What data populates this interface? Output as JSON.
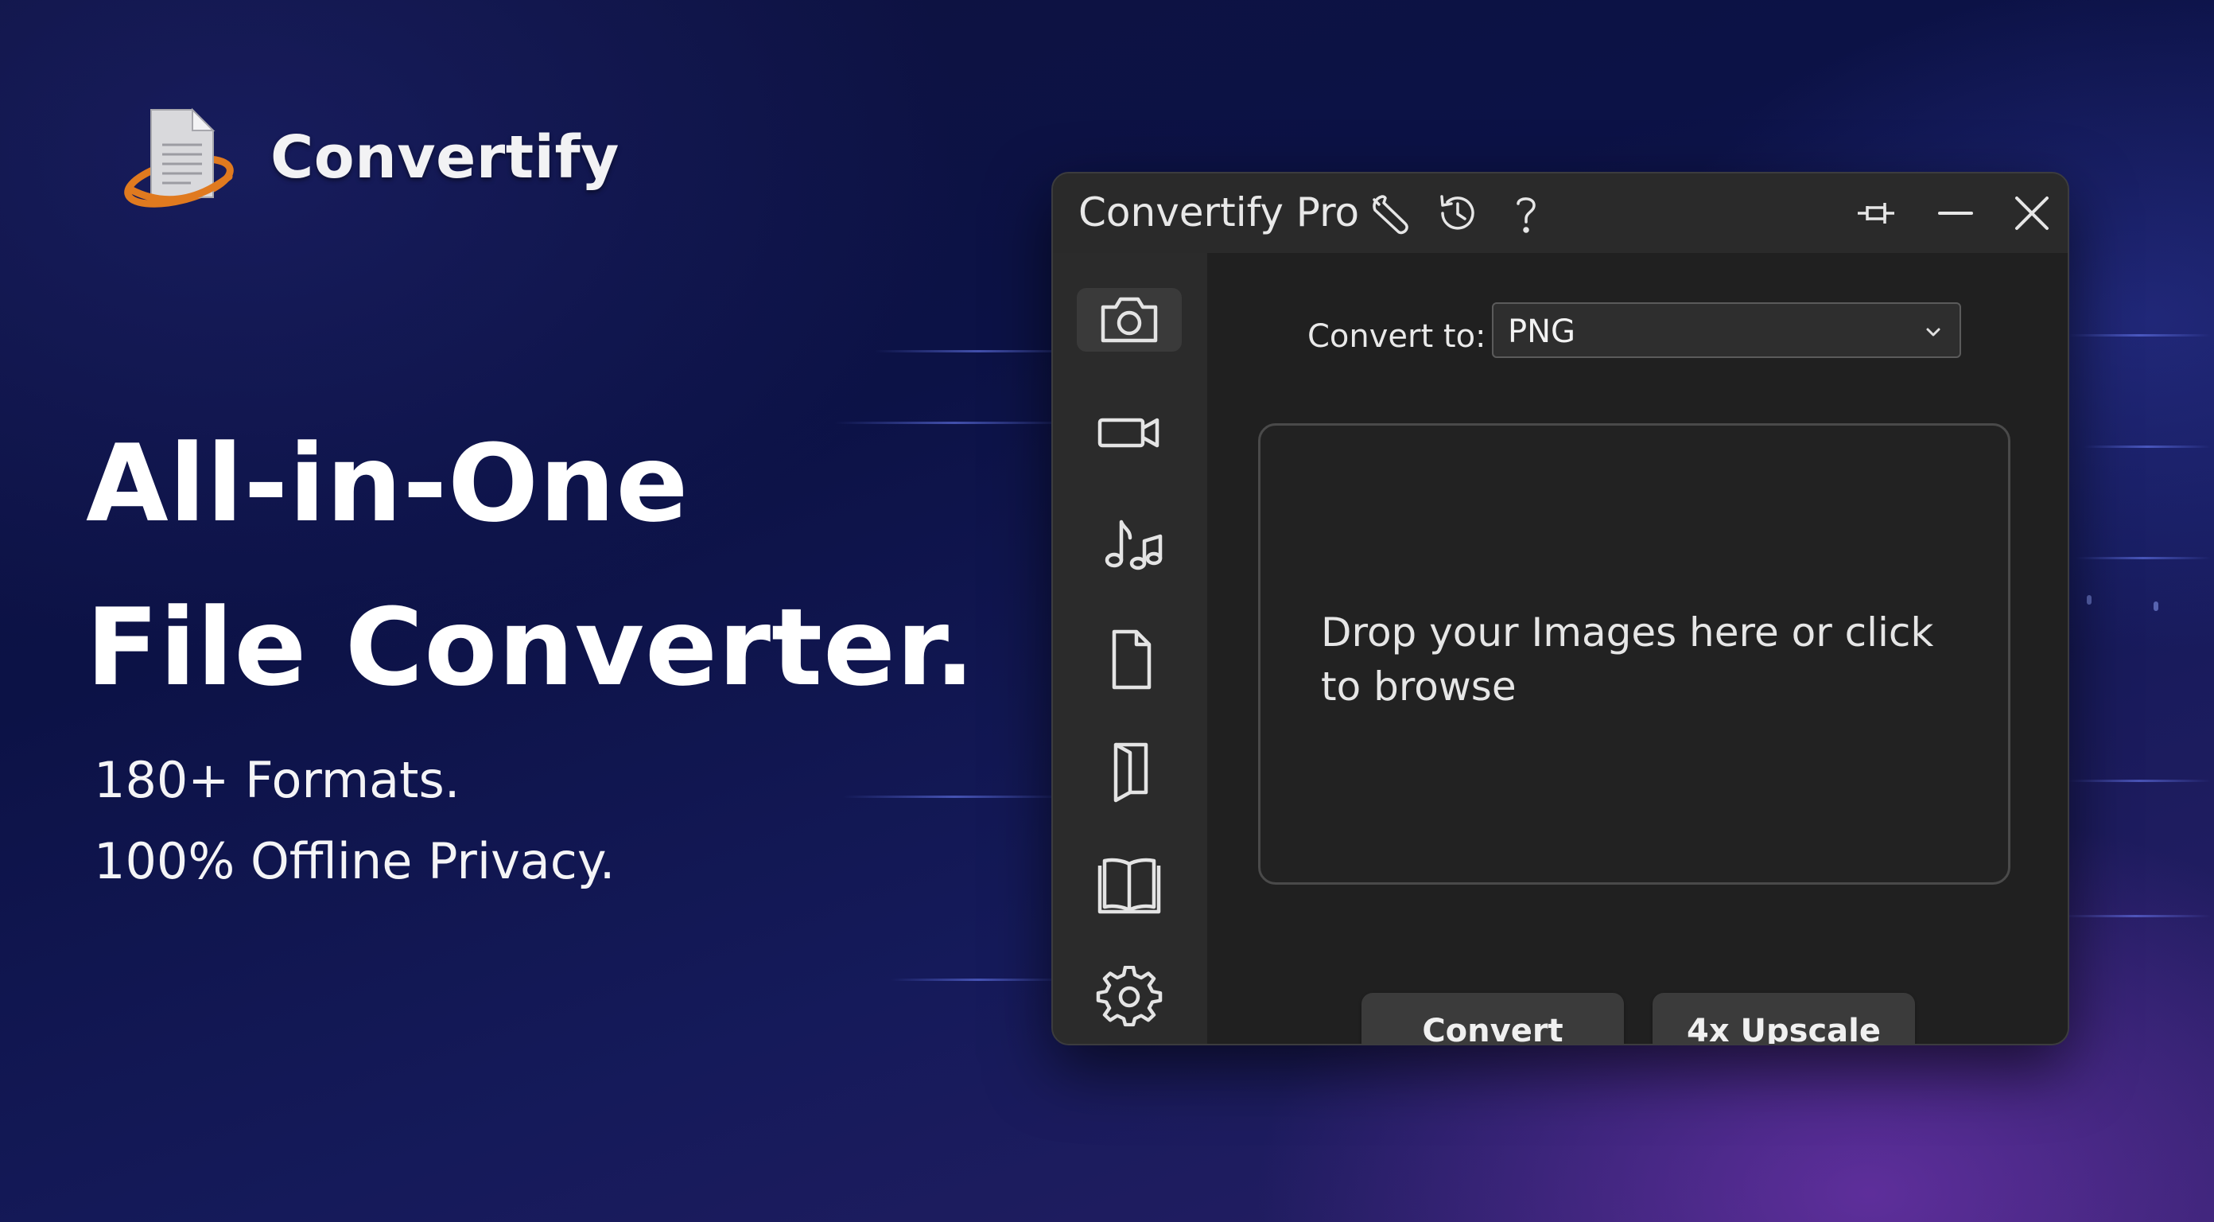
{
  "brand": {
    "name": "Convertify",
    "logo_icon": "document-orbit-icon"
  },
  "hero": {
    "headline_line1": "All-in-One",
    "headline_line2": "File Converter.",
    "sub_line1": "180+ Formats.",
    "sub_line2": "100% Offline Privacy."
  },
  "window": {
    "title": "Convertify Pro",
    "titlebar_icons": [
      "wrench-icon",
      "history-icon",
      "help-icon"
    ],
    "window_controls": [
      "pin-icon",
      "minimize-icon",
      "close-icon"
    ]
  },
  "sidebar": {
    "items": [
      {
        "icon": "camera-icon",
        "active": true
      },
      {
        "icon": "video-camera-icon",
        "active": false
      },
      {
        "icon": "music-note-icon",
        "active": false
      },
      {
        "icon": "document-icon",
        "active": false
      },
      {
        "icon": "folded-document-icon",
        "active": false
      },
      {
        "icon": "open-book-icon",
        "active": false
      },
      {
        "icon": "gear-icon",
        "active": false
      }
    ]
  },
  "main": {
    "convert_label": "Convert to:",
    "format_selected": "PNG",
    "dropzone_text": "Drop your Images here or click to browse",
    "convert_button": "Convert",
    "upscale_button": "4x Upscale"
  },
  "colors": {
    "window_bg": "#2c2c2c",
    "content_bg": "#202020",
    "button_bg": "#3b3b3b",
    "logo_ring": "#e07a1f"
  }
}
